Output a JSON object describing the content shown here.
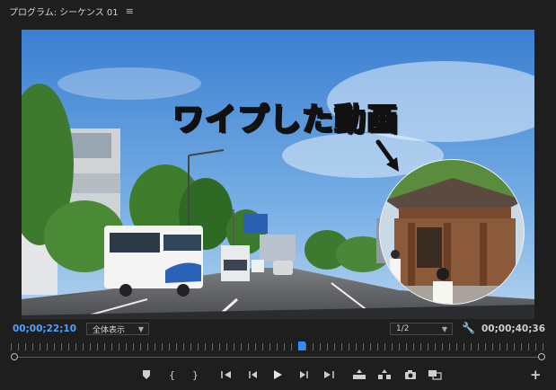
{
  "header": {
    "title": "プログラム: シーケンス 01",
    "menu_icon": "hamburger-icon"
  },
  "viewer": {
    "overlay_text": "ワイプした動画"
  },
  "status": {
    "current_timecode": "00;00;22;10",
    "zoom_value": "全体表示",
    "resolution_value": "1/2",
    "duration_timecode": "00;00;40;36"
  },
  "transport": {
    "icons": [
      "marker-icon",
      "mark-in-icon",
      "mark-out-icon",
      "go-to-in-icon",
      "step-back-icon",
      "play-icon",
      "step-forward-icon",
      "go-to-out-icon",
      "lift-icon",
      "extract-icon",
      "export-frame-icon",
      "compare-view-icon",
      "add-button-icon"
    ]
  }
}
